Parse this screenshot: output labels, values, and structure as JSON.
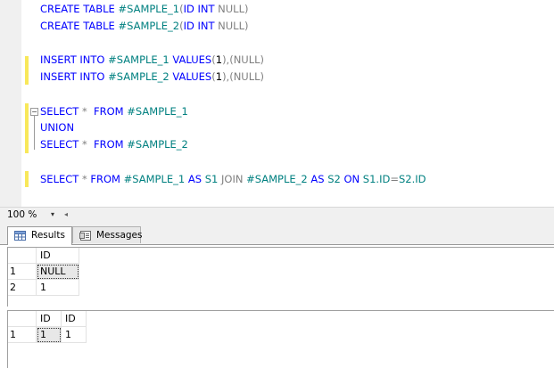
{
  "editor": {
    "lines": [
      {
        "parts": [
          [
            "kw",
            "CREATE TABLE "
          ],
          [
            "tbl",
            "#SAMPLE_1"
          ],
          [
            "gr",
            "("
          ],
          [
            "kw",
            "ID INT "
          ],
          [
            "gr",
            "NULL)"
          ]
        ]
      },
      {
        "parts": [
          [
            "kw",
            "CREATE TABLE "
          ],
          [
            "tbl",
            "#SAMPLE_2"
          ],
          [
            "gr",
            "("
          ],
          [
            "kw",
            "ID INT "
          ],
          [
            "gr",
            "NULL)"
          ]
        ]
      },
      {
        "parts": [
          [
            "kw",
            "INSERT INTO "
          ],
          [
            "tbl",
            "#SAMPLE_1 "
          ],
          [
            "kw",
            "VALUES"
          ],
          [
            "gr",
            "("
          ],
          [
            "num",
            "1"
          ],
          [
            "gr",
            "),(NULL)"
          ]
        ]
      },
      {
        "parts": [
          [
            "kw",
            "INSERT INTO "
          ],
          [
            "tbl",
            "#SAMPLE_2 "
          ],
          [
            "kw",
            "VALUES"
          ],
          [
            "gr",
            "("
          ],
          [
            "num",
            "1"
          ],
          [
            "gr",
            "),(NULL)"
          ]
        ]
      },
      {
        "parts": [
          [
            "kw",
            "SELECT "
          ],
          [
            "gr",
            "* "
          ],
          [
            "kw",
            " FROM "
          ],
          [
            "tbl",
            "#SAMPLE_1"
          ]
        ]
      },
      {
        "parts": [
          [
            "kw",
            "UNION"
          ]
        ]
      },
      {
        "parts": [
          [
            "kw",
            "SELECT "
          ],
          [
            "gr",
            "* "
          ],
          [
            "kw",
            " FROM "
          ],
          [
            "tbl",
            "#SAMPLE_2"
          ]
        ]
      },
      {
        "parts": [
          [
            "kw",
            "SELECT "
          ],
          [
            "gr",
            "* "
          ],
          [
            "kw",
            "FROM "
          ],
          [
            "tbl",
            "#SAMPLE_1 "
          ],
          [
            "kw",
            "AS "
          ],
          [
            "tbl",
            "S1 "
          ],
          [
            "gr",
            "JOIN "
          ],
          [
            "tbl",
            "#SAMPLE_2 "
          ],
          [
            "kw",
            "AS "
          ],
          [
            "tbl",
            "S2 "
          ],
          [
            "kw",
            "ON "
          ],
          [
            "tbl",
            "S1.ID"
          ],
          [
            "gr",
            "="
          ],
          [
            "tbl",
            "S2.ID"
          ]
        ]
      }
    ],
    "collapse_glyph": "−"
  },
  "zoom": {
    "value": "100 %",
    "dropdown_glyph": "▾",
    "scroll_left_glyph": "◂"
  },
  "tabs": {
    "results_label": "Results",
    "messages_label": "Messages"
  },
  "grid1": {
    "headers": [
      "ID"
    ],
    "rows": [
      {
        "num": "1",
        "cells": [
          "NULL"
        ]
      },
      {
        "num": "2",
        "cells": [
          "1"
        ]
      }
    ]
  },
  "grid2": {
    "headers": [
      "ID",
      "ID"
    ],
    "rows": [
      {
        "num": "1",
        "cells": [
          "1",
          "1"
        ]
      }
    ]
  },
  "colors": {
    "keyword": "#0000ff",
    "table": "#008080",
    "operator": "#808080",
    "change_marker": "#f8e85a"
  }
}
